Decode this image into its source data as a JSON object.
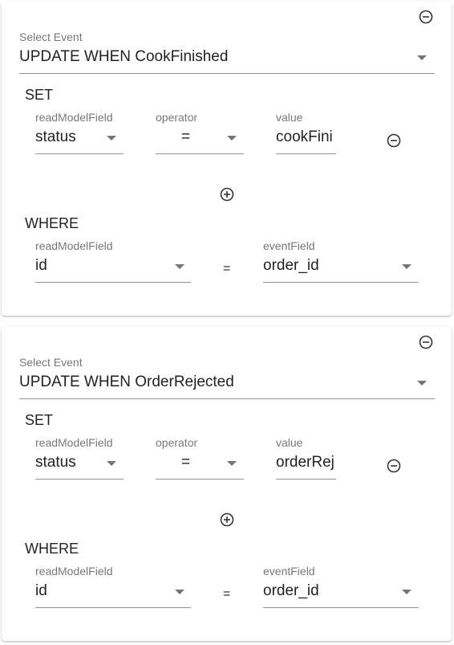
{
  "labels": {
    "select_event": "Select Event",
    "set": "SET",
    "where": "WHERE",
    "read_model_field": "readModelField",
    "operator": "operator",
    "value": "value",
    "event_field": "eventField",
    "equals": "="
  },
  "cards": [
    {
      "event": "UPDATE WHEN CookFinished",
      "set_row": {
        "read_model_field": "status",
        "operator": "=",
        "value": "cookFini"
      },
      "where_row": {
        "read_model_field": "id",
        "equals": "=",
        "event_field": "order_id"
      }
    },
    {
      "event": "UPDATE WHEN OrderRejected",
      "set_row": {
        "read_model_field": "status",
        "operator": "=",
        "value": "orderRej"
      },
      "where_row": {
        "read_model_field": "id",
        "equals": "=",
        "event_field": "order_id"
      }
    }
  ],
  "icons": {
    "remove": "minus-circle-icon",
    "add": "plus-circle-icon",
    "dropdown": "chevron-down-icon"
  }
}
